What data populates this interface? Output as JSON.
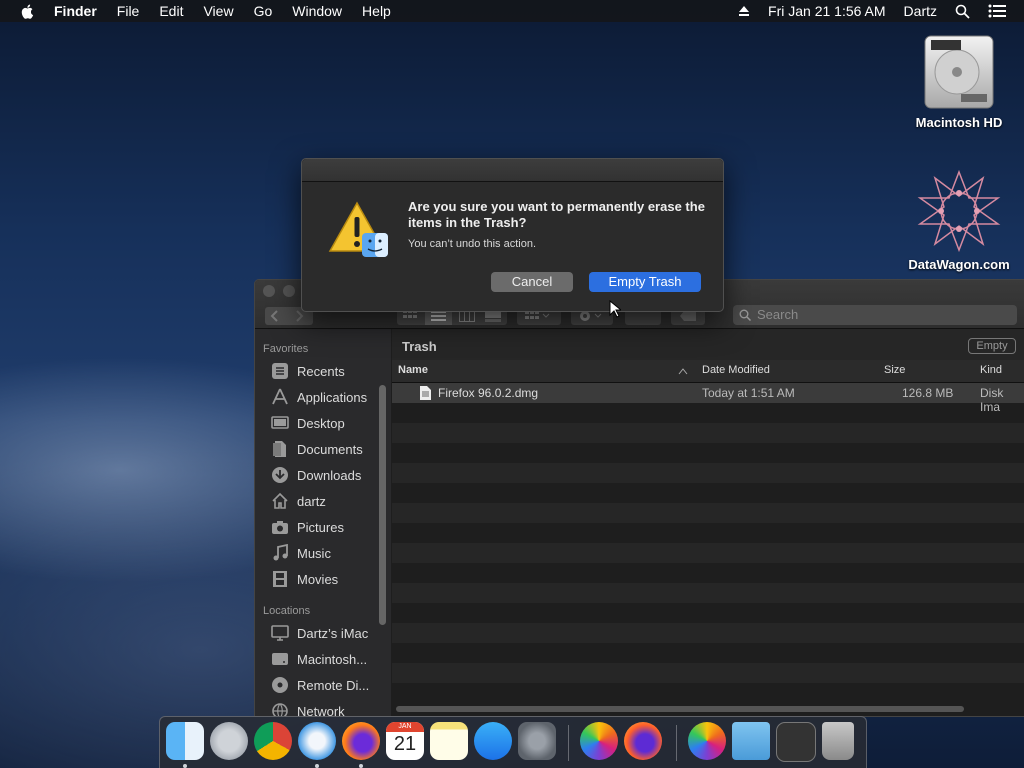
{
  "menubar": {
    "app": "Finder",
    "items": [
      "File",
      "Edit",
      "View",
      "Go",
      "Window",
      "Help"
    ],
    "datetime": "Fri Jan 21  1:56 AM",
    "user": "Dartz"
  },
  "desktop": {
    "icons": [
      {
        "label": "Macintosh HD",
        "icon": "hard-drive-icon"
      },
      {
        "label": "DataWagon.com",
        "icon": "datawagon-logo-icon"
      }
    ]
  },
  "dialog": {
    "message": "Are you sure you want to permanently erase the items in the Trash?",
    "info": "You can’t undo this action.",
    "cancel_label": "Cancel",
    "confirm_label": "Empty Trash"
  },
  "finder": {
    "search_placeholder": "Search",
    "path_title": "Trash",
    "empty_button": "Empty",
    "sidebar": {
      "favorites_label": "Favorites",
      "favorites": [
        {
          "label": "Recents",
          "icon": "clock-icon"
        },
        {
          "label": "Applications",
          "icon": "applications-icon"
        },
        {
          "label": "Desktop",
          "icon": "desktop-icon"
        },
        {
          "label": "Documents",
          "icon": "document-icon"
        },
        {
          "label": "Downloads",
          "icon": "download-icon"
        },
        {
          "label": "dartz",
          "icon": "home-icon"
        },
        {
          "label": "Pictures",
          "icon": "camera-icon"
        },
        {
          "label": "Music",
          "icon": "music-note-icon"
        },
        {
          "label": "Movies",
          "icon": "film-icon"
        }
      ],
      "locations_label": "Locations",
      "locations": [
        {
          "label": "Dartz’s iMac",
          "icon": "computer-icon"
        },
        {
          "label": "Macintosh...",
          "icon": "disk-icon"
        },
        {
          "label": "Remote Di...",
          "icon": "disc-icon"
        },
        {
          "label": "Network",
          "icon": "network-icon"
        }
      ]
    },
    "columns": {
      "name": "Name",
      "date": "Date Modified",
      "size": "Size",
      "kind": "Kind"
    },
    "files": [
      {
        "name": "Firefox 96.0.2.dmg",
        "date": "Today at 1:51 AM",
        "size": "126.8 MB",
        "kind": "Disk Ima"
      }
    ]
  },
  "dock": {
    "apps": [
      "Finder",
      "Launchpad",
      "Chrome",
      "Safari",
      "Firefox",
      "Calendar",
      "Notes",
      "App Store",
      "System Preferences",
      "Photos",
      "Firefox Developer",
      "Photos Alt",
      "Downloads Folder",
      "Screenshot",
      "Trash"
    ],
    "calendar_month": "JAN",
    "calendar_day": "21"
  }
}
